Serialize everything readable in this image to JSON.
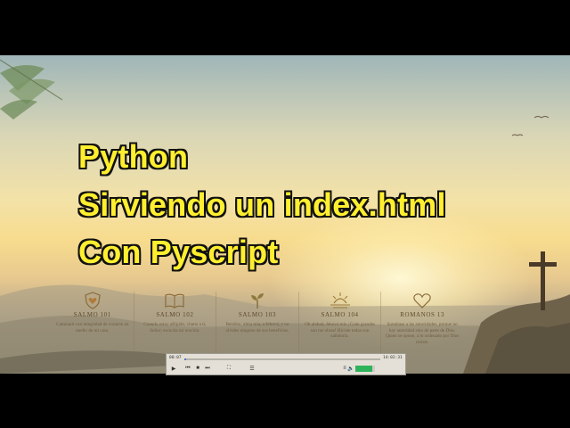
{
  "video": {
    "title_lines": [
      "Python",
      "Sirviendo un index.html",
      "Con Pyscript"
    ],
    "title_color": "#ffef2e"
  },
  "cards": [
    {
      "icon": "heart-shield-icon",
      "title": "SALMO 101",
      "text": "Caminaré con integridad de corazón en medio de mi casa."
    },
    {
      "icon": "open-book-icon",
      "title": "SALMO 102",
      "text": "Cuando estoy afligido, clamo a ti, Señor; escucha mi oración."
    },
    {
      "icon": "sprout-icon",
      "title": "SALMO 103",
      "text": "Bendice, alma mía, a Jehová, y no olvides ninguno de sus beneficios."
    },
    {
      "icon": "sunrise-icon",
      "title": "SALMO 104",
      "text": "Oh alabad, Jehová mío ¡Cuán grandes son tus obras! Hiciste todas con sabiduría."
    },
    {
      "icon": "heart-outline-icon",
      "title": "ROMANOS 13",
      "text": "Sométase a las autoridades, porque no hay autoridad sino de parte de Dios. Quien se opone, a lo ordenado por Dios resiste."
    }
  ],
  "player": {
    "current_time": "00:07",
    "total_time": "14:02:31",
    "progress": 0.01,
    "volume": 0.85,
    "accent_color": "#4a7bd0",
    "volume_color": "#2fb35a"
  }
}
